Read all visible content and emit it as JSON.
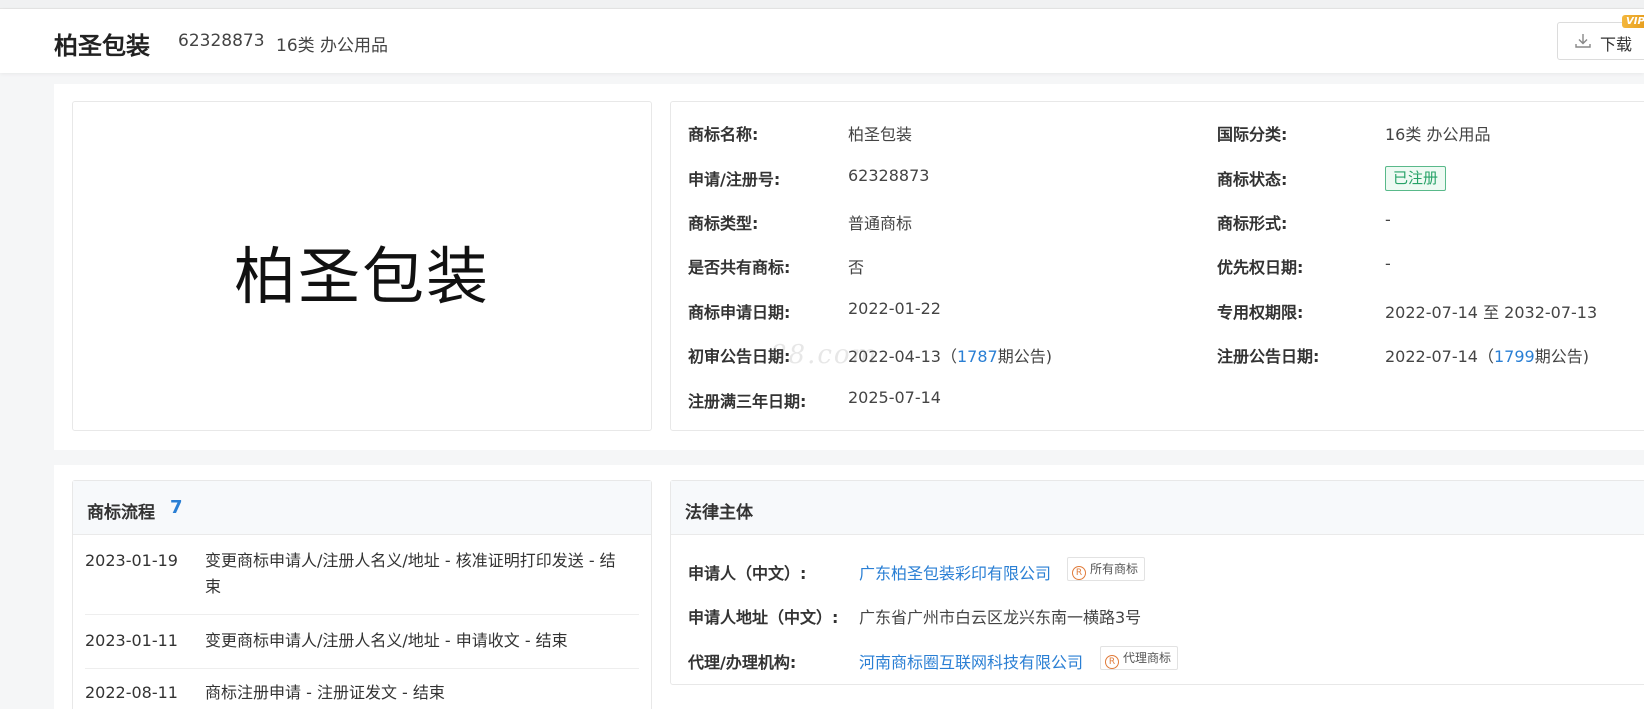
{
  "header": {
    "title": "柏圣包装",
    "reg_no": "62328873",
    "class": "16类 办公用品",
    "download_label": "下载",
    "vip_badge": "VIP"
  },
  "logo": {
    "text": "柏圣包装"
  },
  "watermark": "88.com",
  "info": {
    "name_label": "商标名称:",
    "name": "柏圣包装",
    "regno_label": "申请/注册号:",
    "regno": "62328873",
    "type_label": "商标类型:",
    "type": "普通商标",
    "shared_label": "是否共有商标:",
    "shared": "否",
    "apply_date_label": "商标申请日期:",
    "apply_date": "2022-01-22",
    "prelim_label": "初审公告日期:",
    "prelim_date": "2022-04-13（",
    "prelim_issue": "1787",
    "prelim_suffix": "期公告)",
    "three_year_label": "注册满三年日期:",
    "three_year": "2025-07-14",
    "intl_class_label": "国际分类:",
    "intl_class": "16类 办公用品",
    "status_label": "商标状态:",
    "status": "已注册",
    "form_label": "商标形式:",
    "form": "-",
    "priority_label": "优先权日期:",
    "priority": "-",
    "exclusive_label": "专用权期限:",
    "exclusive": "2022-07-14 至 2032-07-13",
    "reg_pub_label": "注册公告日期:",
    "reg_pub_date": "2022-07-14（",
    "reg_pub_issue": "1799",
    "reg_pub_suffix": "期公告)"
  },
  "flow": {
    "title": "商标流程",
    "count": "7",
    "items": [
      {
        "date": "2023-01-19",
        "text": "变更商标申请人/注册人名义/地址 - 核准证明打印发送 - 结束"
      },
      {
        "date": "2023-01-11",
        "text": "变更商标申请人/注册人名义/地址 - 申请收文 - 结束"
      },
      {
        "date": "2022-08-11",
        "text": "商标注册申请 - 注册证发文 - 结束"
      }
    ]
  },
  "legal": {
    "title": "法律主体",
    "applicant_label": "申请人（中文）:",
    "applicant": "广东柏圣包装彩印有限公司",
    "applicant_tag": "所有商标",
    "address_label": "申请人地址（中文）:",
    "address": "广东省广州市白云区龙兴东南一横路3号",
    "agent_label": "代理/办理机构:",
    "agent": "河南商标圈互联网科技有限公司",
    "agent_tag": "代理商标",
    "r_symbol": "R"
  },
  "colors": {
    "link": "#2a7fd4",
    "status_green": "#26a267",
    "tag_orange": "#e07b3a"
  },
  "icons": [
    "download-icon",
    "registered-icon"
  ]
}
